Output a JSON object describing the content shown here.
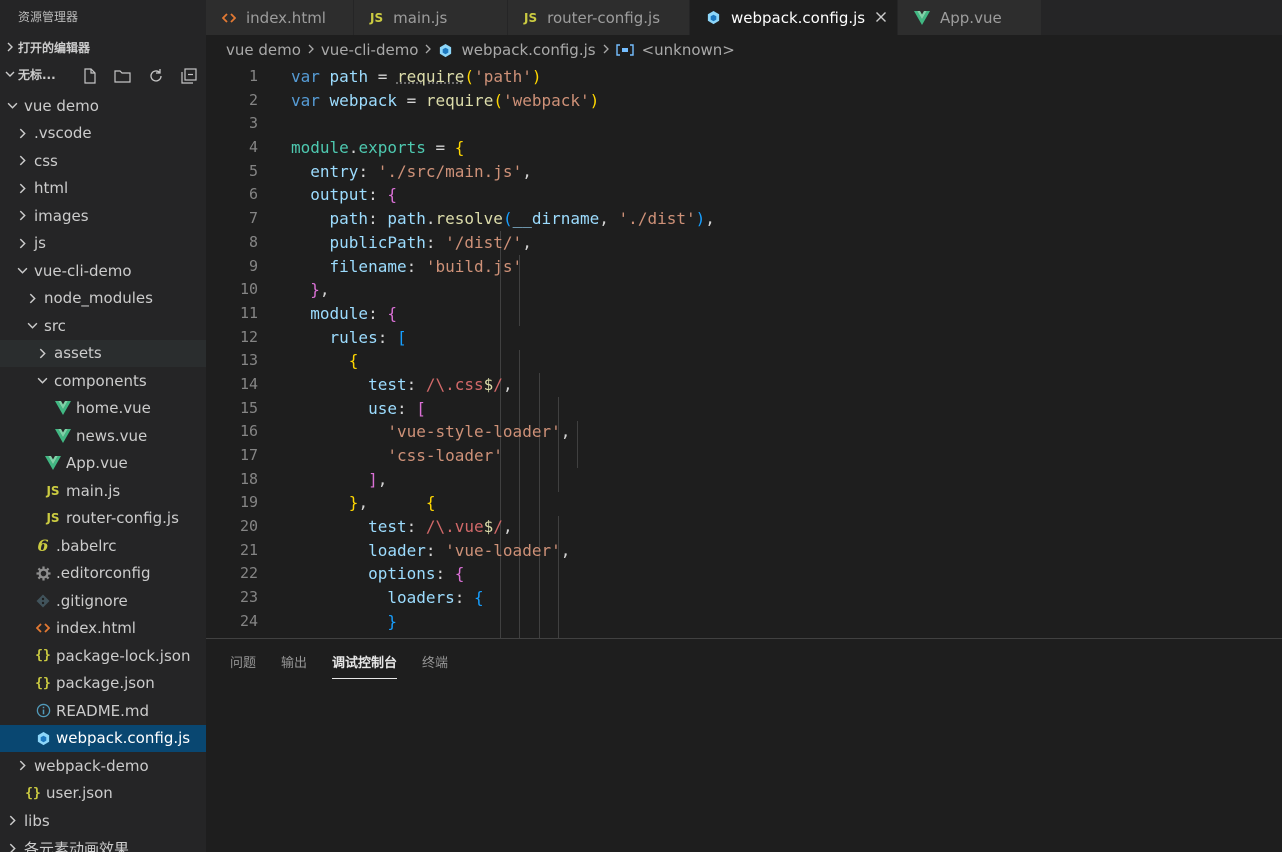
{
  "sidebar": {
    "title": "资源管理器",
    "open_editors_label": "打开的编辑器",
    "workspace_label": "无标...",
    "tree": [
      {
        "label": "vue demo",
        "depth": 0,
        "twisty": "open",
        "icon": ""
      },
      {
        "label": ".vscode",
        "depth": 1,
        "twisty": "closed",
        "icon": ""
      },
      {
        "label": "css",
        "depth": 1,
        "twisty": "closed",
        "icon": ""
      },
      {
        "label": "html",
        "depth": 1,
        "twisty": "closed",
        "icon": ""
      },
      {
        "label": "images",
        "depth": 1,
        "twisty": "closed",
        "icon": ""
      },
      {
        "label": "js",
        "depth": 1,
        "twisty": "closed",
        "icon": ""
      },
      {
        "label": "vue-cli-demo",
        "depth": 1,
        "twisty": "open",
        "icon": ""
      },
      {
        "label": "node_modules",
        "depth": 2,
        "twisty": "closed",
        "icon": ""
      },
      {
        "label": "src",
        "depth": 2,
        "twisty": "open",
        "icon": ""
      },
      {
        "label": "assets",
        "depth": 3,
        "twisty": "closed",
        "icon": "",
        "state": "hover"
      },
      {
        "label": "components",
        "depth": 3,
        "twisty": "open",
        "icon": ""
      },
      {
        "label": "home.vue",
        "depth": 4,
        "twisty": "none",
        "icon": "vue"
      },
      {
        "label": "news.vue",
        "depth": 4,
        "twisty": "none",
        "icon": "vue"
      },
      {
        "label": "App.vue",
        "depth": 3,
        "twisty": "none",
        "icon": "vue"
      },
      {
        "label": "main.js",
        "depth": 3,
        "twisty": "none",
        "icon": "js"
      },
      {
        "label": "router-config.js",
        "depth": 3,
        "twisty": "none",
        "icon": "js"
      },
      {
        "label": ".babelrc",
        "depth": 2,
        "twisty": "none",
        "icon": "babel"
      },
      {
        "label": ".editorconfig",
        "depth": 2,
        "twisty": "none",
        "icon": "gear"
      },
      {
        "label": ".gitignore",
        "depth": 2,
        "twisty": "none",
        "icon": "git"
      },
      {
        "label": "index.html",
        "depth": 2,
        "twisty": "none",
        "icon": "html"
      },
      {
        "label": "package-lock.json",
        "depth": 2,
        "twisty": "none",
        "icon": "json"
      },
      {
        "label": "package.json",
        "depth": 2,
        "twisty": "none",
        "icon": "json"
      },
      {
        "label": "README.md",
        "depth": 2,
        "twisty": "none",
        "icon": "info"
      },
      {
        "label": "webpack.config.js",
        "depth": 2,
        "twisty": "none",
        "icon": "webpack",
        "state": "selected"
      },
      {
        "label": "webpack-demo",
        "depth": 1,
        "twisty": "closed",
        "icon": ""
      },
      {
        "label": "user.json",
        "depth": 1,
        "twisty": "none",
        "icon": "json"
      },
      {
        "label": "libs",
        "depth": 0,
        "twisty": "closed",
        "icon": ""
      },
      {
        "label": "各元素动画效果",
        "depth": 0,
        "twisty": "closed",
        "icon": ""
      }
    ]
  },
  "tabs": [
    {
      "label": "index.html",
      "icon": "html",
      "width": 148,
      "active": false
    },
    {
      "label": "main.js",
      "icon": "js",
      "width": 154,
      "active": false
    },
    {
      "label": "router-config.js",
      "icon": "js",
      "width": 182,
      "active": false
    },
    {
      "label": "webpack.config.js",
      "icon": "webpack",
      "width": 208,
      "active": true
    },
    {
      "label": "App.vue",
      "icon": "vue",
      "width": 144,
      "active": false
    }
  ],
  "breadcrumb": {
    "parts": [
      "vue demo",
      "vue-cli-demo",
      "webpack.config.js",
      "<unknown>"
    ]
  },
  "editor": {
    "lines": [
      "1",
      "2",
      "3",
      "4",
      "5",
      "6",
      "7",
      "8",
      "9",
      "10",
      "11",
      "12",
      "13",
      "14",
      "15",
      "16",
      "17",
      "18",
      "19",
      "20",
      "21",
      "22",
      "23",
      "24"
    ]
  },
  "panel": {
    "tabs": [
      "问题",
      "输出",
      "调试控制台",
      "终端"
    ],
    "active": "调试控制台"
  },
  "colors": {
    "selection": "#094771",
    "vue_green": "#41b883",
    "js_yellow": "#cbcb41",
    "html_orange": "#e37933",
    "webpack_blue": "#8dd6f9"
  }
}
